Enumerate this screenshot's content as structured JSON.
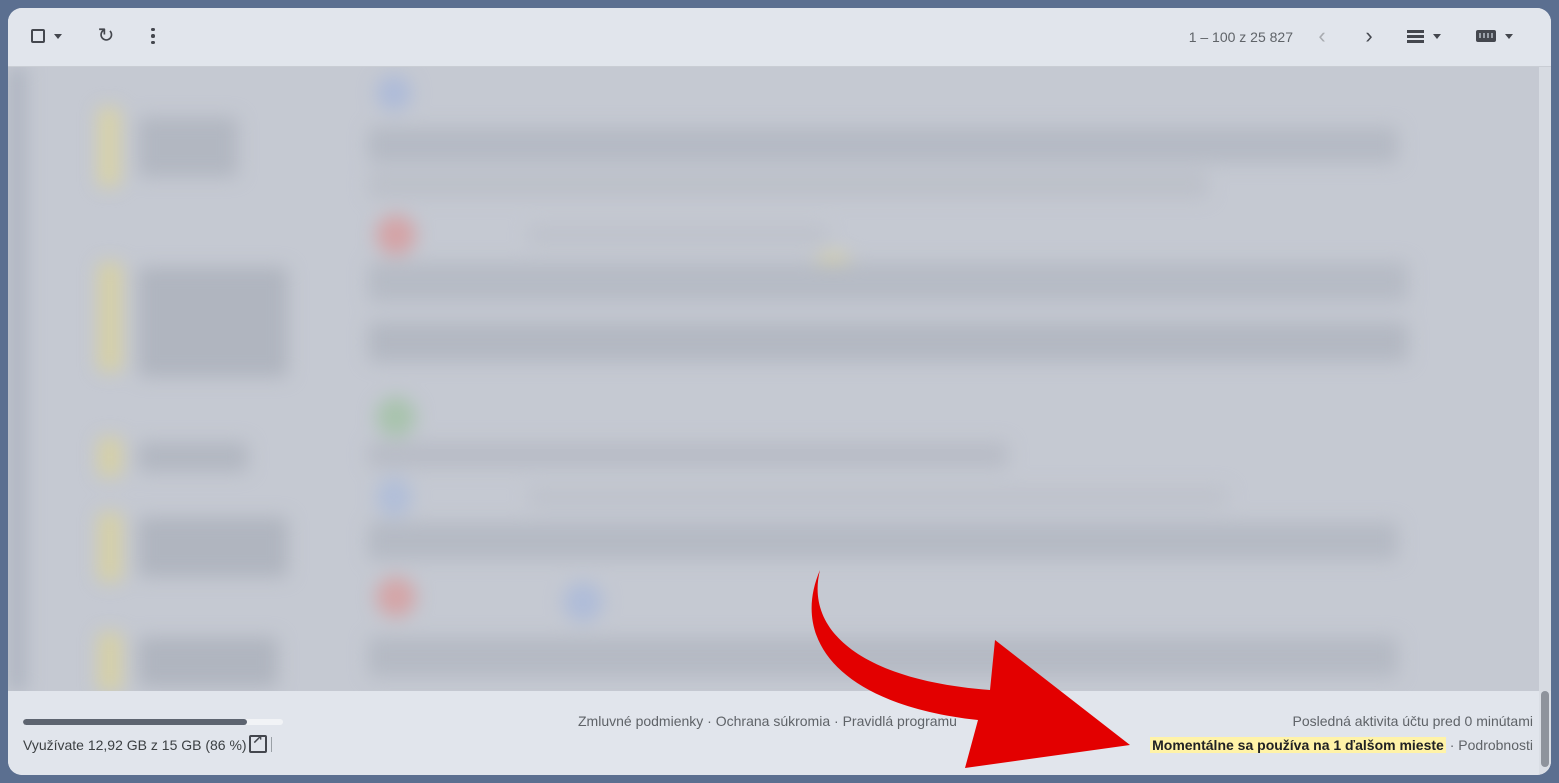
{
  "toolbar": {
    "pager_range": "1 – 100 z 25 827"
  },
  "footer": {
    "storage_used_fraction": 0.86,
    "storage_text": "Využívate 12,92 GB z 15 GB (86 %)",
    "links": [
      "Zmluvné podmienky",
      "Ochrana súkromia",
      "Pravidlá programu"
    ],
    "link_separator": " · ",
    "last_activity": "Posledná aktivita účtu pred 0 minútami",
    "session_highlight": "Momentálne sa používa na 1 ďalšom mieste",
    "details_sep": " · ",
    "details_link": "Podrobnosti"
  },
  "colors": {
    "arrow": "#e30000",
    "highlight": "#fff3a8",
    "outer_bg": "#5b6f90"
  },
  "icons": [
    "checkbox-icon",
    "chevron-down-icon",
    "refresh-icon",
    "more-vert-icon",
    "chevron-left-icon",
    "chevron-right-icon",
    "density-icon",
    "keyboard-icon",
    "open-in-new-icon"
  ]
}
